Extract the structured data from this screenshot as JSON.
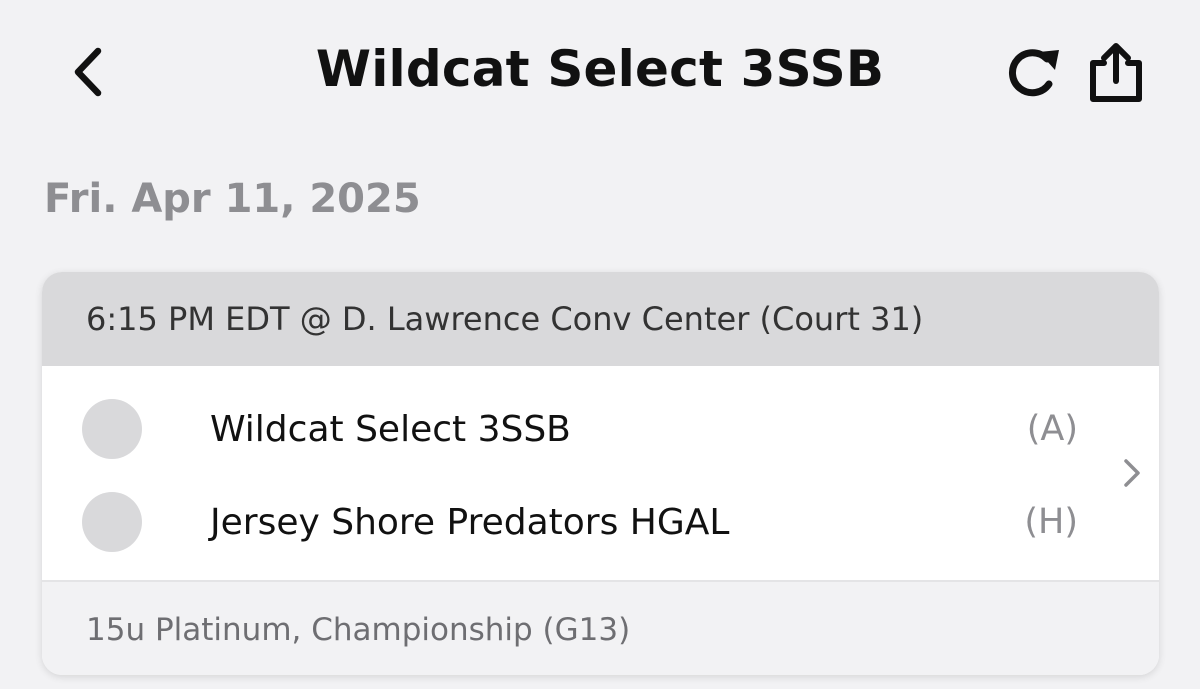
{
  "header": {
    "title": "Wildcat Select 3SSB",
    "back_icon": "chevron-left-icon",
    "refresh_icon": "refresh-icon",
    "share_icon": "share-icon"
  },
  "schedule": {
    "date": "Fri. Apr 11, 2025",
    "games": [
      {
        "time_location": "6:15 PM EDT @ D. Lawrence Conv Center (Court 31)",
        "teams": [
          {
            "name": "Wildcat Select 3SSB",
            "side": "(A)"
          },
          {
            "name": "Jersey Shore Predators HGAL",
            "side": "(H)"
          }
        ],
        "details": "15u Platinum, Championship (G13)"
      }
    ]
  },
  "colors": {
    "background": "#f2f2f4",
    "card_header": "#d9d9db",
    "muted_text": "#8e8e92"
  }
}
